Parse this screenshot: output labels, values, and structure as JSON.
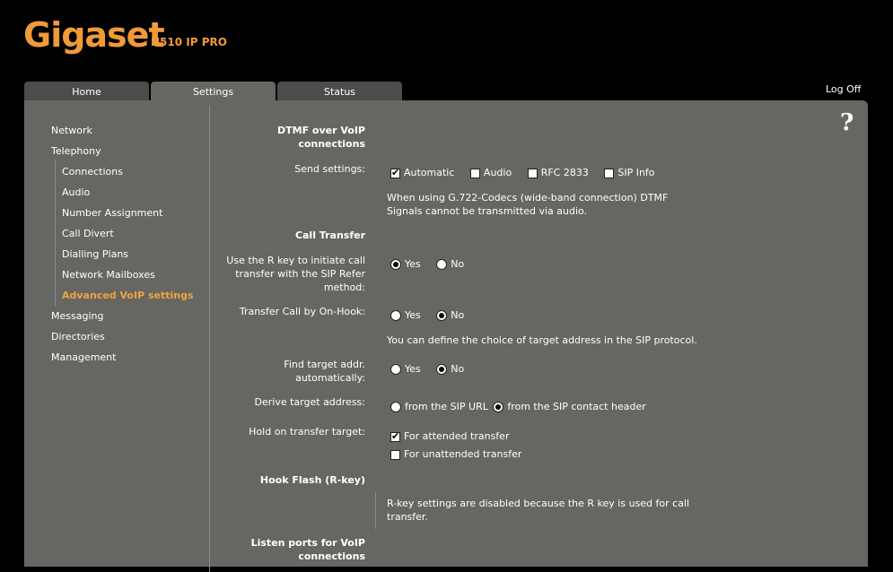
{
  "brand": {
    "logo": "Gigaset",
    "model": "N510 IP PRO"
  },
  "tabs": [
    {
      "label": "Home"
    },
    {
      "label": "Settings"
    },
    {
      "label": "Status"
    }
  ],
  "logoff": "Log Off",
  "help": "?",
  "nav": {
    "network": "Network",
    "telephony": "Telephony",
    "sub": [
      "Connections",
      "Audio",
      "Number Assignment",
      "Call Divert",
      "Dialling Plans",
      "Network Mailboxes",
      "Advanced VoIP settings"
    ],
    "messaging": "Messaging",
    "directories": "Directories",
    "management": "Management"
  },
  "dtmf": {
    "title": "DTMF over VoIP connections",
    "send_label": "Send settings:",
    "options": [
      {
        "label": "Automatic",
        "checked": true
      },
      {
        "label": "Audio",
        "checked": false
      },
      {
        "label": "RFC 2833",
        "checked": false
      },
      {
        "label": "SIP Info",
        "checked": false
      }
    ],
    "note": "When using G.722-Codecs (wide-band connection) DTMF Signals cannot be transmitted via audio."
  },
  "transfer": {
    "title": "Call Transfer",
    "rkey_label": "Use the R key to initiate call transfer with the SIP Refer method:",
    "onhook_label": "Transfer Call by On-Hook:",
    "info": "You can define the choice of target address in the SIP protocol.",
    "find_label": "Find target addr. automatically:",
    "derive_label": "Derive target address:",
    "derive_opt1": "from the SIP URL",
    "derive_opt2": "from the SIP contact header",
    "hold_label": "Hold on transfer target:",
    "hold_opt1": "For attended transfer",
    "hold_opt2": "For unattended transfer",
    "yes": "Yes",
    "no": "No"
  },
  "hookflash": {
    "title": "Hook Flash (R-key)",
    "note": "R-key settings are disabled because the R key is used for call transfer."
  },
  "ports": {
    "title": "Listen ports for VoIP connections"
  }
}
